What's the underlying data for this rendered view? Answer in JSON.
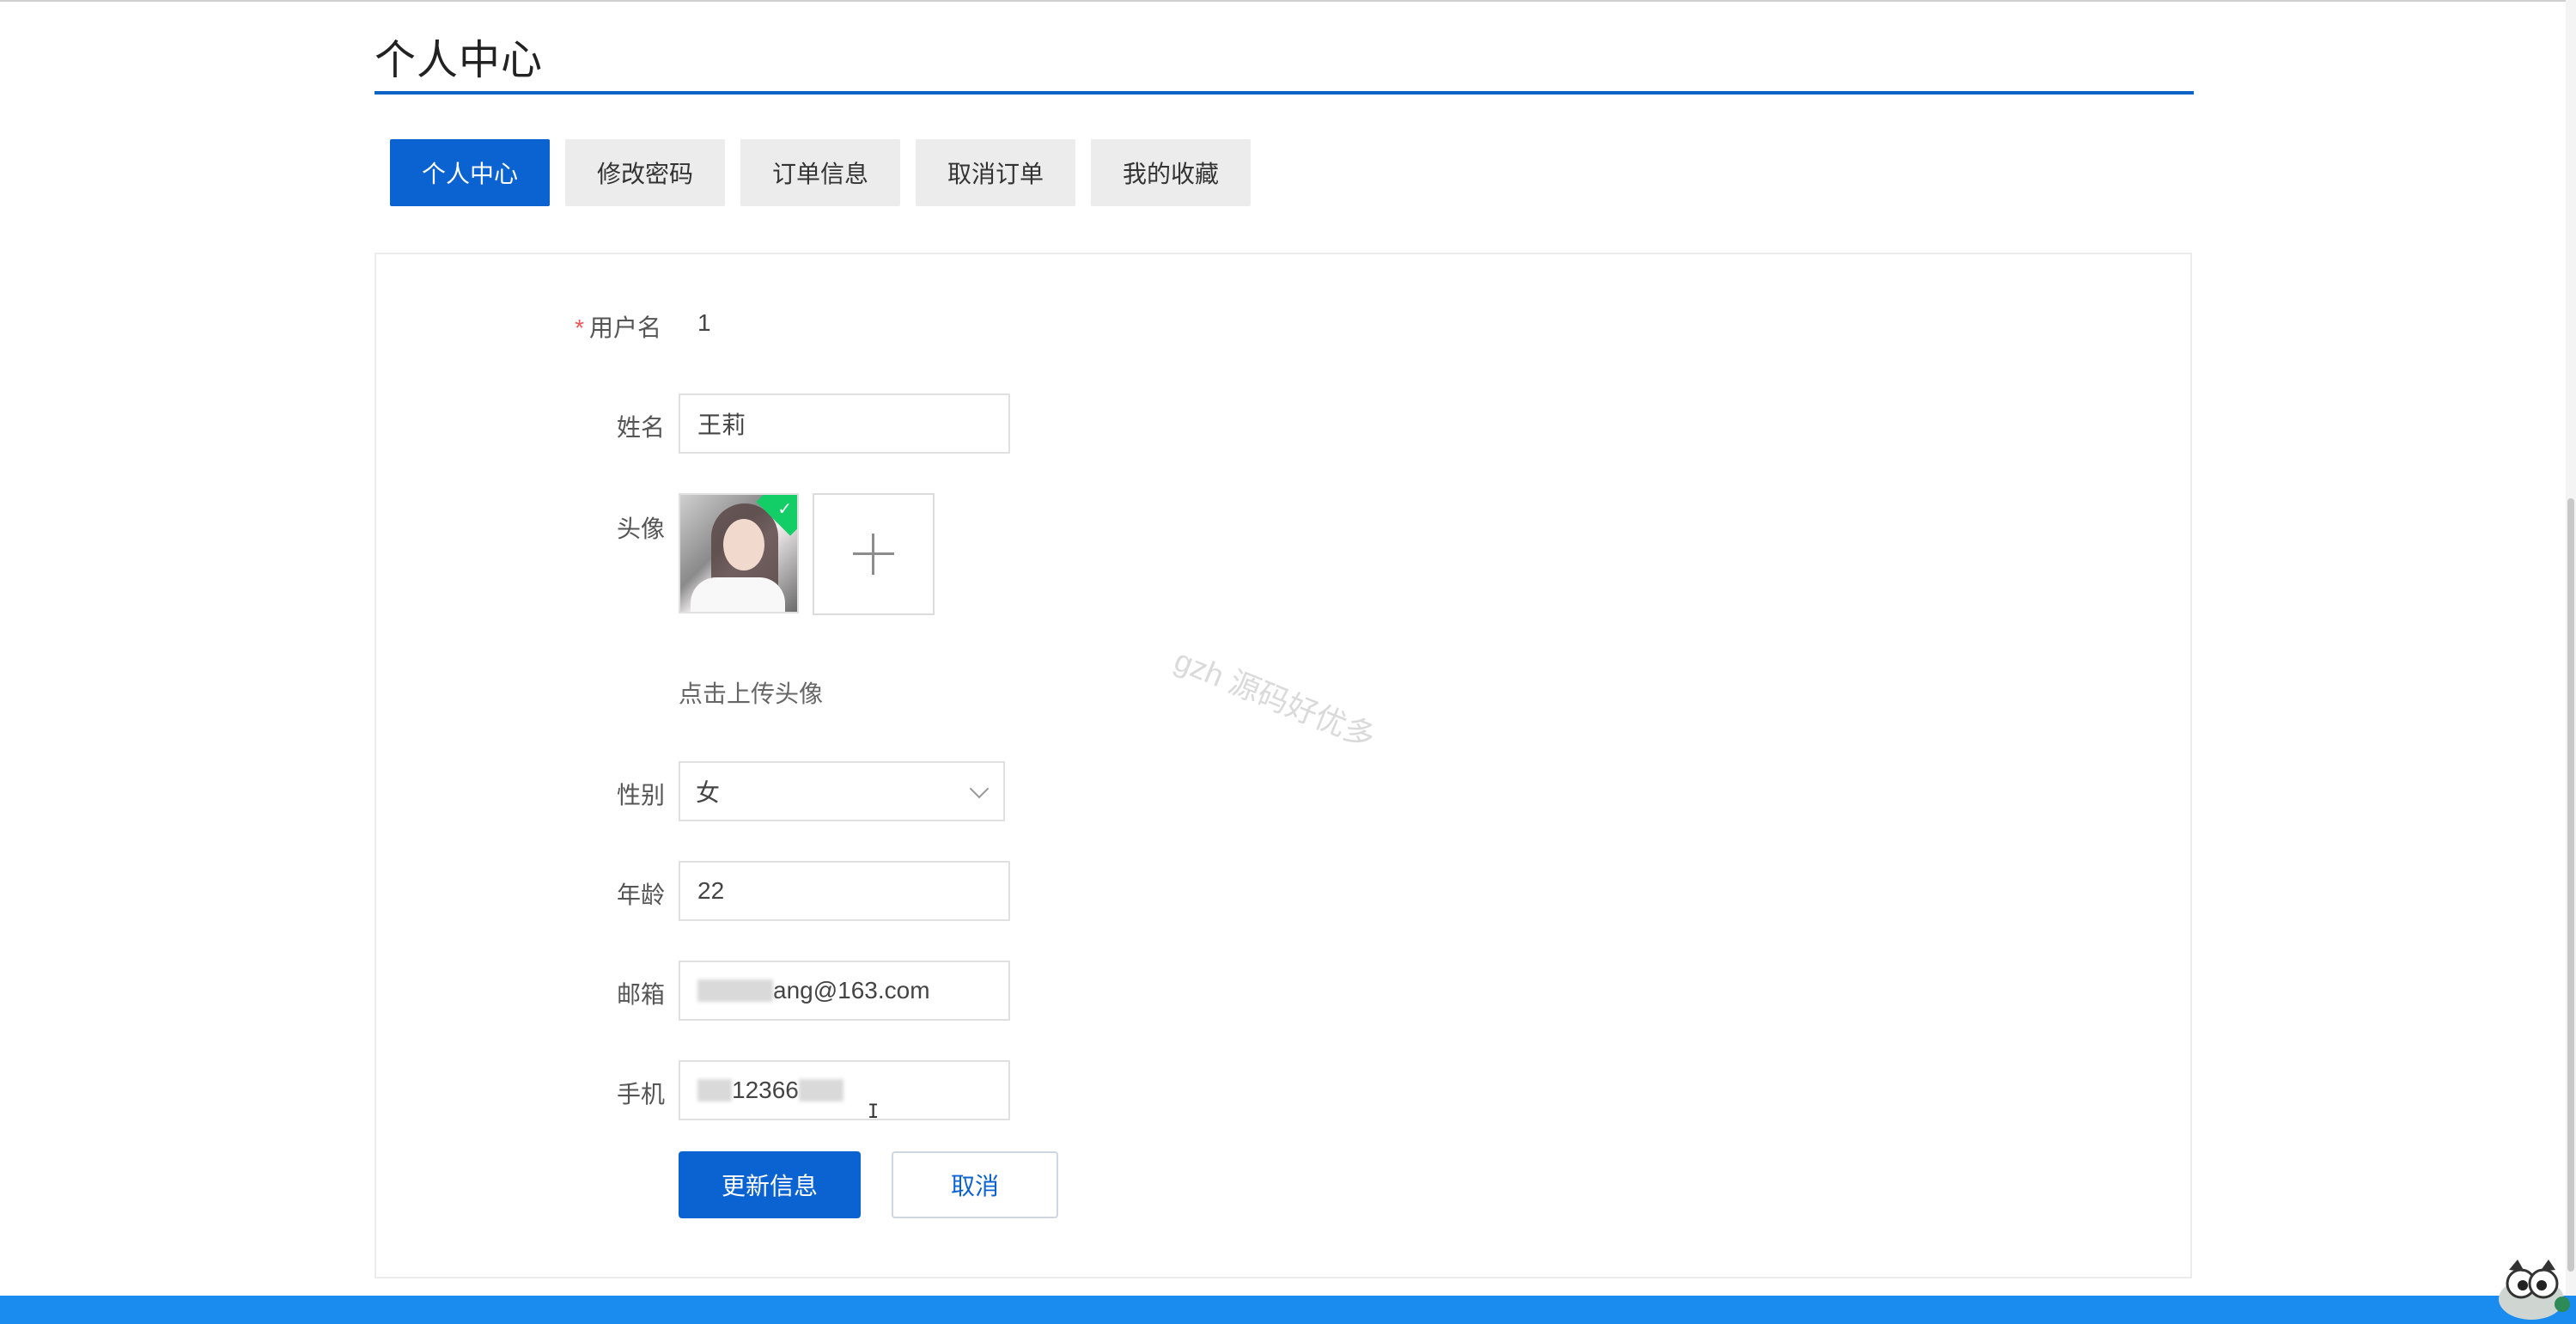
{
  "page": {
    "title": "个人中心"
  },
  "tabs": [
    {
      "label": "个人中心",
      "active": true
    },
    {
      "label": "修改密码",
      "active": false
    },
    {
      "label": "订单信息",
      "active": false
    },
    {
      "label": "取消订单",
      "active": false
    },
    {
      "label": "我的收藏",
      "active": false
    }
  ],
  "form": {
    "username": {
      "label": "用户名",
      "required_mark": "*",
      "value": "1"
    },
    "name": {
      "label": "姓名",
      "value": "王莉"
    },
    "avatar": {
      "label": "头像",
      "hint": "点击上传头像",
      "upload_icon": "plus-icon",
      "status_icon": "check-icon"
    },
    "gender": {
      "label": "性别",
      "value": "女",
      "icon": "chevron-down-icon"
    },
    "age": {
      "label": "年龄",
      "value": "22"
    },
    "email": {
      "label": "邮箱",
      "value_visible": "ang@163.com"
    },
    "phone": {
      "label": "手机",
      "value_visible": "12366"
    }
  },
  "buttons": {
    "submit": "更新信息",
    "cancel": "取消"
  },
  "watermark": "gzh 源码好优多",
  "colors": {
    "accent": "#0b63d1",
    "underline": "#0e63c6",
    "tab_inactive_bg": "#ececec",
    "footer": "#1a8cf0",
    "required": "#e55555"
  }
}
